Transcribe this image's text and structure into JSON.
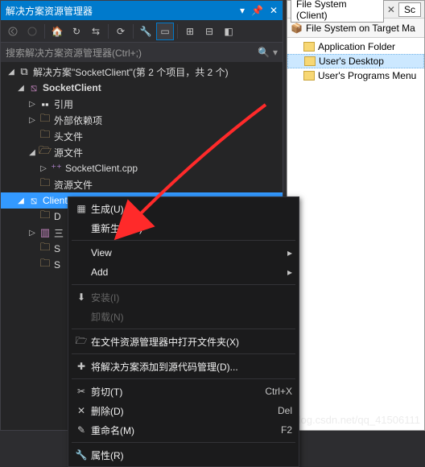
{
  "left": {
    "title": "解决方案资源管理器",
    "search_placeholder": "搜索解决方案资源管理器(Ctrl+;)",
    "solution_label": "解决方案\"SocketClient\"(第 2 个项目，共 2 个)",
    "tree": {
      "project1": "SocketClient",
      "refs": "引用",
      "ext": "外部依赖项",
      "headers": "头文件",
      "sources": "源文件",
      "cpp": "SocketClient.cpp",
      "resources": "资源文件",
      "project2": "Client",
      "stub_d": "D",
      "stub_3": "三",
      "stub_s1": "S",
      "stub_s2": "S"
    }
  },
  "right": {
    "tab": "File System (Client)",
    "tab2": "Sc",
    "title": "File System on Target Ma",
    "rows": {
      "app": "Application Folder",
      "desktop": "User's Desktop",
      "menu": "User's Programs Menu"
    }
  },
  "ctx": {
    "build": "生成(U)",
    "rebuild": "重新生成(E)",
    "view": "View",
    "add": "Add",
    "install": "安装(I)",
    "unload": "卸载(N)",
    "open_folder": "在文件资源管理器中打开文件夹(X)",
    "add_scc": "将解决方案添加到源代码管理(D)...",
    "cut": "剪切(T)",
    "cut_short": "Ctrl+X",
    "delete": "删除(D)",
    "delete_short": "Del",
    "rename": "重命名(M)",
    "rename_short": "F2",
    "props": "属性(R)"
  },
  "watermark": "https://blog.csdn.net/qq_41506111"
}
